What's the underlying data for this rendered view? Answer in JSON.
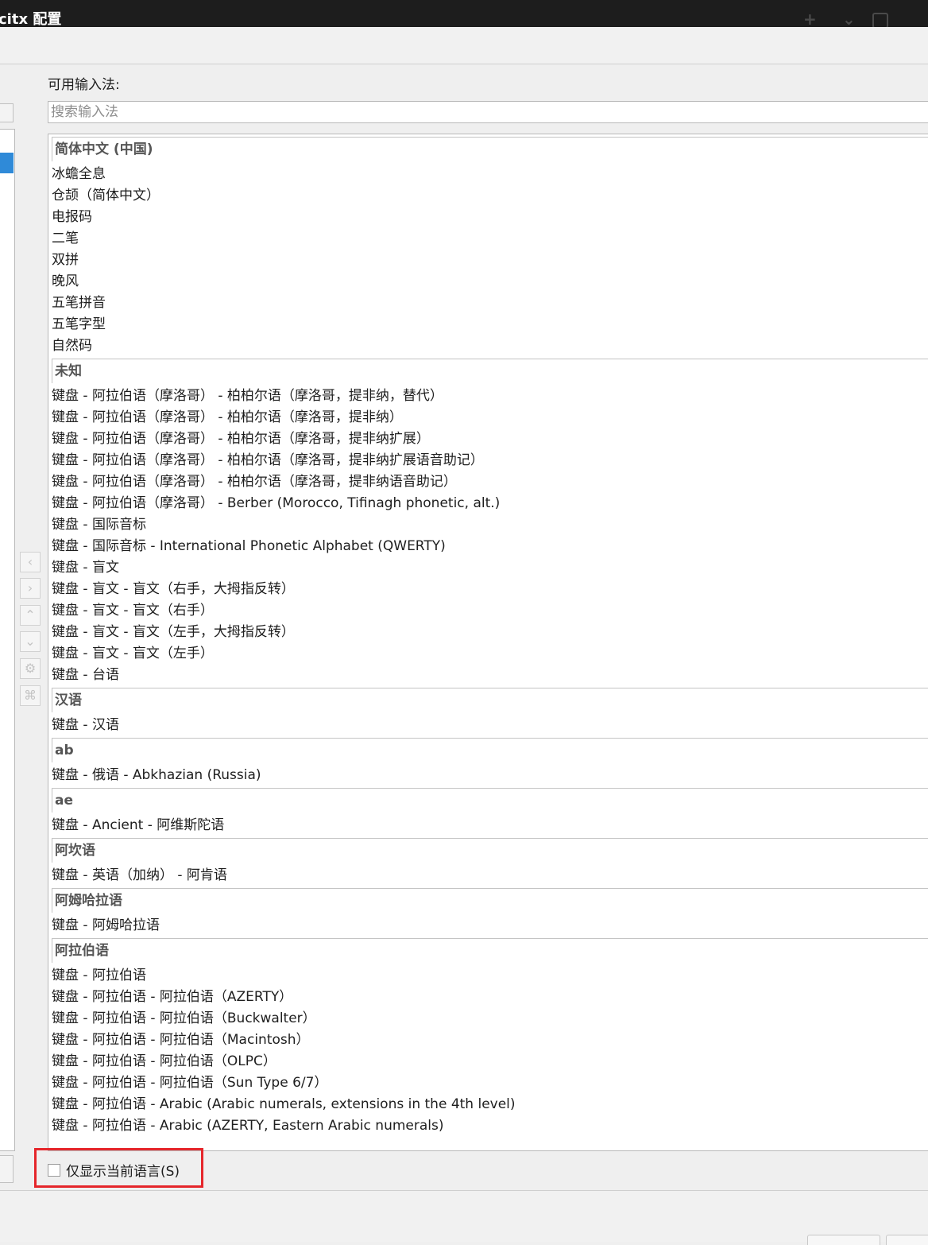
{
  "window": {
    "title": "citx 配置",
    "controls": [
      "add-icon",
      "chevron-down-icon",
      "restore-icon"
    ]
  },
  "available": {
    "label": "可用输入法:",
    "search_placeholder": "搜索输入法",
    "search_value": ""
  },
  "groups": [
    {
      "header": "简体中文 (中国)",
      "items": [
        "冰蟾全息",
        "仓颉（简体中文）",
        "电报码",
        "二笔",
        "双拼",
        "晚风",
        "五笔拼音",
        "五笔字型",
        "自然码"
      ]
    },
    {
      "header": "未知",
      "items": [
        "键盘 - 阿拉伯语（摩洛哥） - 柏柏尔语（摩洛哥，提非纳，替代）",
        "键盘 - 阿拉伯语（摩洛哥） - 柏柏尔语（摩洛哥，提非纳）",
        "键盘 - 阿拉伯语（摩洛哥） - 柏柏尔语（摩洛哥，提非纳扩展）",
        "键盘 - 阿拉伯语（摩洛哥） - 柏柏尔语（摩洛哥，提非纳扩展语音助记）",
        "键盘 - 阿拉伯语（摩洛哥） - 柏柏尔语（摩洛哥，提非纳语音助记）",
        "键盘 - 阿拉伯语（摩洛哥） - Berber (Morocco, Tifinagh phonetic, alt.)",
        "键盘 - 国际音标",
        "键盘 - 国际音标 - International Phonetic Alphabet (QWERTY)",
        "键盘 - 盲文",
        "键盘 - 盲文 - 盲文（右手，大拇指反转）",
        "键盘 - 盲文 - 盲文（右手）",
        "键盘 - 盲文 - 盲文（左手，大拇指反转）",
        "键盘 - 盲文 - 盲文（左手）",
        "键盘 - 台语"
      ]
    },
    {
      "header": "汉语",
      "items": [
        "键盘 - 汉语"
      ]
    },
    {
      "header": "ab",
      "items": [
        "键盘 - 俄语 - Abkhazian (Russia)"
      ]
    },
    {
      "header": "ae",
      "items": [
        "键盘 - Ancient - 阿维斯陀语"
      ]
    },
    {
      "header": "阿坎语",
      "items": [
        "键盘 - 英语（加纳） - 阿肯语"
      ]
    },
    {
      "header": "阿姆哈拉语",
      "items": [
        "键盘 - 阿姆哈拉语"
      ]
    },
    {
      "header": "阿拉伯语",
      "items": [
        "键盘 - 阿拉伯语",
        "键盘 - 阿拉伯语 - 阿拉伯语（AZERTY）",
        "键盘 - 阿拉伯语 - 阿拉伯语（Buckwalter）",
        "键盘 - 阿拉伯语 - 阿拉伯语（Macintosh）",
        "键盘 - 阿拉伯语 - 阿拉伯语（OLPC）",
        "键盘 - 阿拉伯语 - 阿拉伯语（Sun Type 6/7）",
        "键盘 - 阿拉伯语 - Arabic (Arabic numerals, extensions in the 4th level)",
        "键盘 - 阿拉伯语 - Arabic (AZERTY, Eastern Arabic numerals)"
      ]
    }
  ],
  "side_buttons": [
    {
      "name": "move-left-button",
      "icon": "chevron-left-icon",
      "glyph": "‹"
    },
    {
      "name": "move-right-button",
      "icon": "chevron-right-icon",
      "glyph": "›"
    },
    {
      "name": "move-up-button",
      "icon": "chevron-up-icon",
      "glyph": "⌃"
    },
    {
      "name": "move-down-button",
      "icon": "chevron-down-icon",
      "glyph": "⌄"
    },
    {
      "name": "configure-button",
      "icon": "settings-icon",
      "glyph": "⚙"
    },
    {
      "name": "keyboard-layout-button",
      "icon": "command-key-icon",
      "glyph": "⌘"
    }
  ],
  "show_current_language": {
    "label": "仅显示当前语言(S)",
    "checked": false
  },
  "colors": {
    "titlebar": "#1d1d1d",
    "selection": "#2f8ad8",
    "highlight_box": "#e5262b"
  }
}
